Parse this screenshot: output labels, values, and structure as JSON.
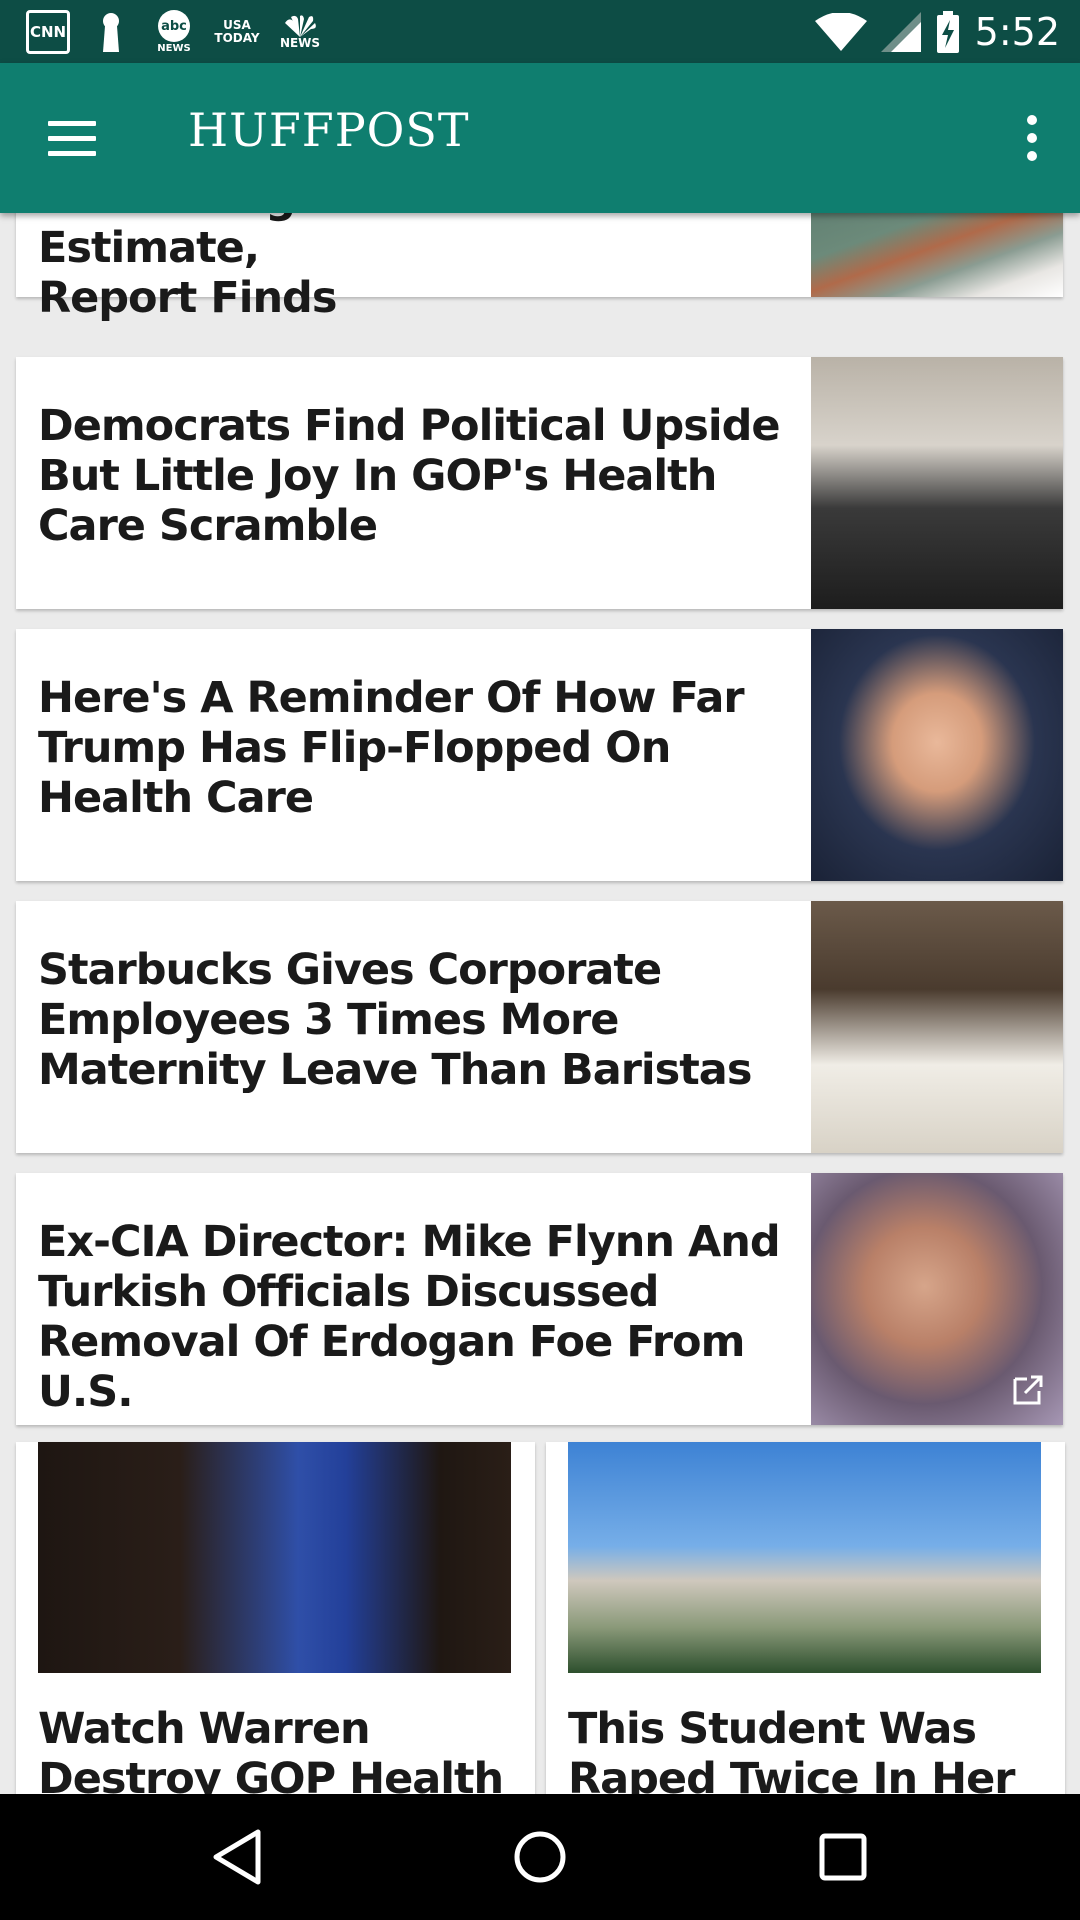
{
  "status_bar": {
    "notifications": [
      {
        "name": "cnn-icon",
        "label": "CNN"
      },
      {
        "name": "keyhole-icon",
        "label": ""
      },
      {
        "name": "abc-news-icon",
        "label": "abc",
        "sub": "NEWS"
      },
      {
        "name": "usa-today-icon",
        "label": "USA",
        "sub": "TODAY"
      },
      {
        "name": "nbc-news-icon",
        "label": "NEWS"
      }
    ],
    "time": "5:52"
  },
  "app_bar": {
    "title": "HUFFPOST"
  },
  "feed": {
    "partial_card": {
      "headline_line1": "Times Larger Than Initial Estimate,",
      "headline_line2": "Report Finds"
    },
    "cards": [
      {
        "headline": "Democrats Find Political Upside But Little Joy In GOP's Health Care Scramble"
      },
      {
        "headline": "Here's A Reminder Of How Far Trump Has Flip-Flopped On Health Care"
      },
      {
        "headline": "Starbucks Gives Corporate Employees 3 Times More Maternity Leave Than Baristas"
      },
      {
        "headline": "Ex-CIA Director: Mike Flynn And Turkish Officials Discussed Removal Of Erdogan Foe From U.S."
      }
    ],
    "half_cards": [
      {
        "headline": "Watch Warren Destroy GOP Health Care Bill In"
      },
      {
        "headline": "This Student Was Raped Twice In Her"
      }
    ]
  },
  "colors": {
    "status_bar": "#0d4d45",
    "app_bar": "#0f7e6f",
    "background": "#ebebeb"
  }
}
